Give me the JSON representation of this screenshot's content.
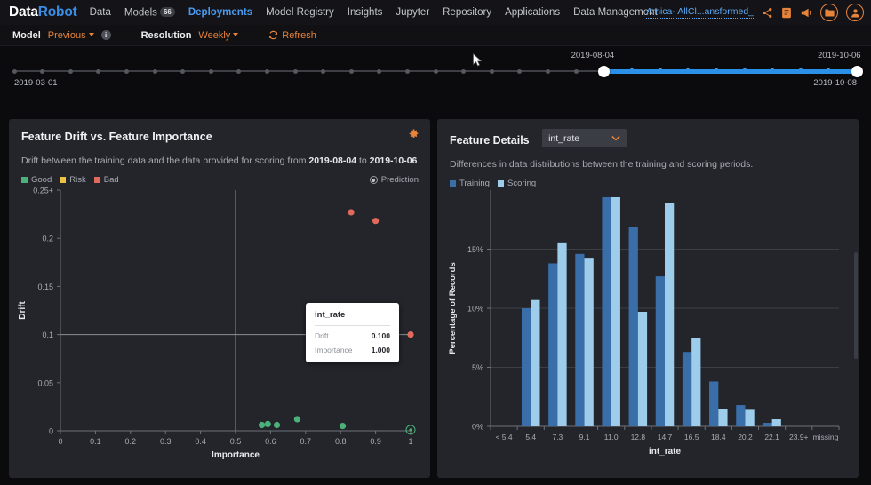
{
  "brand": {
    "part1": "Data",
    "part2": "Robot"
  },
  "nav": {
    "items": [
      {
        "label": "Data",
        "badge": null,
        "active": false
      },
      {
        "label": "Models",
        "badge": "66",
        "active": false
      },
      {
        "label": "Deployments",
        "badge": null,
        "active": true
      },
      {
        "label": "Model Registry",
        "badge": null,
        "active": false
      },
      {
        "label": "Insights",
        "badge": null,
        "active": false
      },
      {
        "label": "Jupyter",
        "badge": null,
        "active": false
      },
      {
        "label": "Repository",
        "badge": null,
        "active": false
      },
      {
        "label": "Applications",
        "badge": null,
        "active": false
      },
      {
        "label": "Data Management",
        "badge": null,
        "active": false
      }
    ],
    "project": "Amica- AllCl...ansformed_",
    "icons": [
      "share-icon",
      "notes-icon",
      "megaphone-icon",
      "folder-icon",
      "user-avatar-icon"
    ],
    "accent": "#e8833a",
    "active_color": "#4a9bf0"
  },
  "toolbar": {
    "model_label": "Model",
    "model_value": "Previous",
    "resolution_label": "Resolution",
    "resolution_value": "Weekly",
    "refresh_label": "Refresh",
    "info_glyph": "i"
  },
  "timeline": {
    "start_label": "2019-03-01",
    "end_label": "2019-10-08",
    "sel_start_label": "2019-08-04",
    "sel_end_label": "2019-10-06",
    "total_ticks": 31,
    "sel_start_index": 21,
    "sel_end_index": 30
  },
  "left_panel": {
    "title": "Feature Drift vs. Feature Importance",
    "subtitle_pre": "Drift between the training data and the data provided for scoring from ",
    "subtitle_from": "2019-08-04",
    "subtitle_mid": " to ",
    "subtitle_to": "2019-10-06",
    "legend": [
      {
        "label": "Good",
        "color": "#4cb07a"
      },
      {
        "label": "Risk",
        "color": "#edc242"
      },
      {
        "label": "Bad",
        "color": "#e06b5c"
      }
    ],
    "prediction_label": "Prediction",
    "gear_icon": "gear-icon",
    "tooltip": {
      "feature": "int_rate",
      "rows": [
        {
          "key": "Drift",
          "value": "0.100"
        },
        {
          "key": "Importance",
          "value": "1.000"
        }
      ]
    }
  },
  "right_panel": {
    "title": "Feature Details",
    "dropdown_value": "int_rate",
    "subtitle": "Differences in data distributions between the training and scoring periods.",
    "legend": [
      {
        "label": "Training",
        "color": "#3a6ea8"
      },
      {
        "label": "Scoring",
        "color": "#9dcdea"
      }
    ]
  },
  "chart_data": [
    {
      "type": "scatter",
      "title": "Feature Drift vs. Feature Importance",
      "xlabel": "Importance",
      "ylabel": "Drift",
      "xlim": [
        0,
        1
      ],
      "ylim": [
        0,
        0.25
      ],
      "xticks": [
        "0",
        "0.1",
        "0.2",
        "0.3",
        "0.4",
        "0.5",
        "0.6",
        "0.7",
        "0.8",
        "0.9",
        "1"
      ],
      "yticks": [
        "0",
        "0.05",
        "0.1",
        "0.15",
        "0.2",
        "0.25+"
      ],
      "reference_lines": {
        "horizontal": 0.1,
        "vertical": 0.5
      },
      "grid": false,
      "legend_position": "top-left",
      "points": [
        {
          "x": 0.83,
          "y": 0.227,
          "status": "Bad",
          "color": "#e06b5c"
        },
        {
          "x": 0.9,
          "y": 0.218,
          "status": "Bad",
          "color": "#e06b5c"
        },
        {
          "x": 1.0,
          "y": 0.1,
          "status": "Bad",
          "color": "#e06b5c",
          "feature": "int_rate",
          "selected": true
        },
        {
          "x": 0.575,
          "y": 0.006,
          "status": "Good",
          "color": "#4cb07a"
        },
        {
          "x": 0.592,
          "y": 0.007,
          "status": "Good",
          "color": "#4cb07a"
        },
        {
          "x": 0.618,
          "y": 0.006,
          "status": "Good",
          "color": "#4cb07a"
        },
        {
          "x": 0.676,
          "y": 0.012,
          "status": "Good",
          "color": "#4cb07a"
        },
        {
          "x": 0.806,
          "y": 0.005,
          "status": "Good",
          "color": "#4cb07a"
        },
        {
          "x": 1.0,
          "y": 0.001,
          "status": "Good",
          "color": "#4cb07a",
          "highlighted": true
        }
      ]
    },
    {
      "type": "bar",
      "title": "Feature Details",
      "xlabel": "int_rate",
      "ylabel": "Percentage of Records",
      "ylim": [
        0,
        20
      ],
      "yticks": [
        "0%",
        "5%",
        "10%",
        "15%"
      ],
      "grid": true,
      "legend_position": "top-left",
      "categories": [
        "< 5.4",
        "5.4",
        "7.3",
        "9.1",
        "11.0",
        "12.8",
        "14.7",
        "16.5",
        "18.4",
        "20.2",
        "22.1",
        "23.9+",
        "missing"
      ],
      "series": [
        {
          "name": "Training",
          "color": "#3a6ea8",
          "values": [
            0,
            10.0,
            13.8,
            14.6,
            19.4,
            16.9,
            12.7,
            6.3,
            3.8,
            1.8,
            0.3,
            0,
            0
          ]
        },
        {
          "name": "Scoring",
          "color": "#9dcdea",
          "values": [
            0,
            10.7,
            15.5,
            14.2,
            19.4,
            9.7,
            18.9,
            7.5,
            1.5,
            1.4,
            0.6,
            0,
            0
          ]
        }
      ]
    }
  ]
}
